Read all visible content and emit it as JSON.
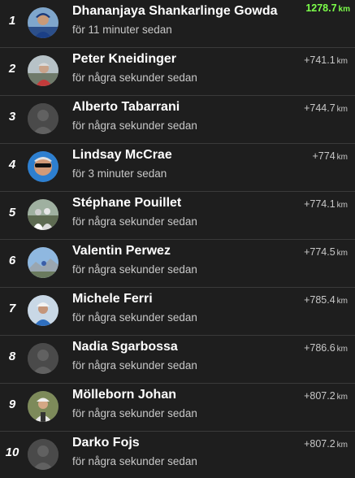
{
  "accent_color": "#7cff4a",
  "rows": [
    {
      "rank": "1",
      "name": "Dhananjaya Shankarlinge Gowda",
      "time": "för 11 minuter sedan",
      "gap": "1278.7",
      "unit": "km",
      "avatar": "photo-cyclist-blue"
    },
    {
      "rank": "2",
      "name": "Peter Kneidinger",
      "time": "för några sekunder sedan",
      "gap": "+741.1",
      "unit": "km",
      "avatar": "photo-cyclist-outdoor"
    },
    {
      "rank": "3",
      "name": "Alberto Tabarrani",
      "time": "för några sekunder sedan",
      "gap": "+744.7",
      "unit": "km",
      "avatar": "default-user-icon"
    },
    {
      "rank": "4",
      "name": "Lindsay McCrae",
      "time": "för 3 minuter sedan",
      "gap": "+774",
      "unit": "km",
      "avatar": "photo-face-sunglasses"
    },
    {
      "rank": "5",
      "name": "Stéphane Pouillet",
      "time": "för några sekunder sedan",
      "gap": "+774.1",
      "unit": "km",
      "avatar": "photo-group-outdoor"
    },
    {
      "rank": "6",
      "name": "Valentin Perwez",
      "time": "för några sekunder sedan",
      "gap": "+774.5",
      "unit": "km",
      "avatar": "photo-mountain-sky"
    },
    {
      "rank": "7",
      "name": "Michele Ferri",
      "time": "för några sekunder sedan",
      "gap": "+785.4",
      "unit": "km",
      "avatar": "photo-cyclist-helmet"
    },
    {
      "rank": "8",
      "name": "Nadia Sgarbossa",
      "time": "för några sekunder sedan",
      "gap": "+786.6",
      "unit": "km",
      "avatar": "default-user-icon"
    },
    {
      "rank": "9",
      "name": "Mölleborn Johan",
      "time": "för några sekunder sedan",
      "gap": "+807.2",
      "unit": "km",
      "avatar": "photo-cyclist-road"
    },
    {
      "rank": "10",
      "name": "Darko Fojs",
      "time": "för några sekunder sedan",
      "gap": "+807.2",
      "unit": "km",
      "avatar": "default-user-icon"
    }
  ]
}
